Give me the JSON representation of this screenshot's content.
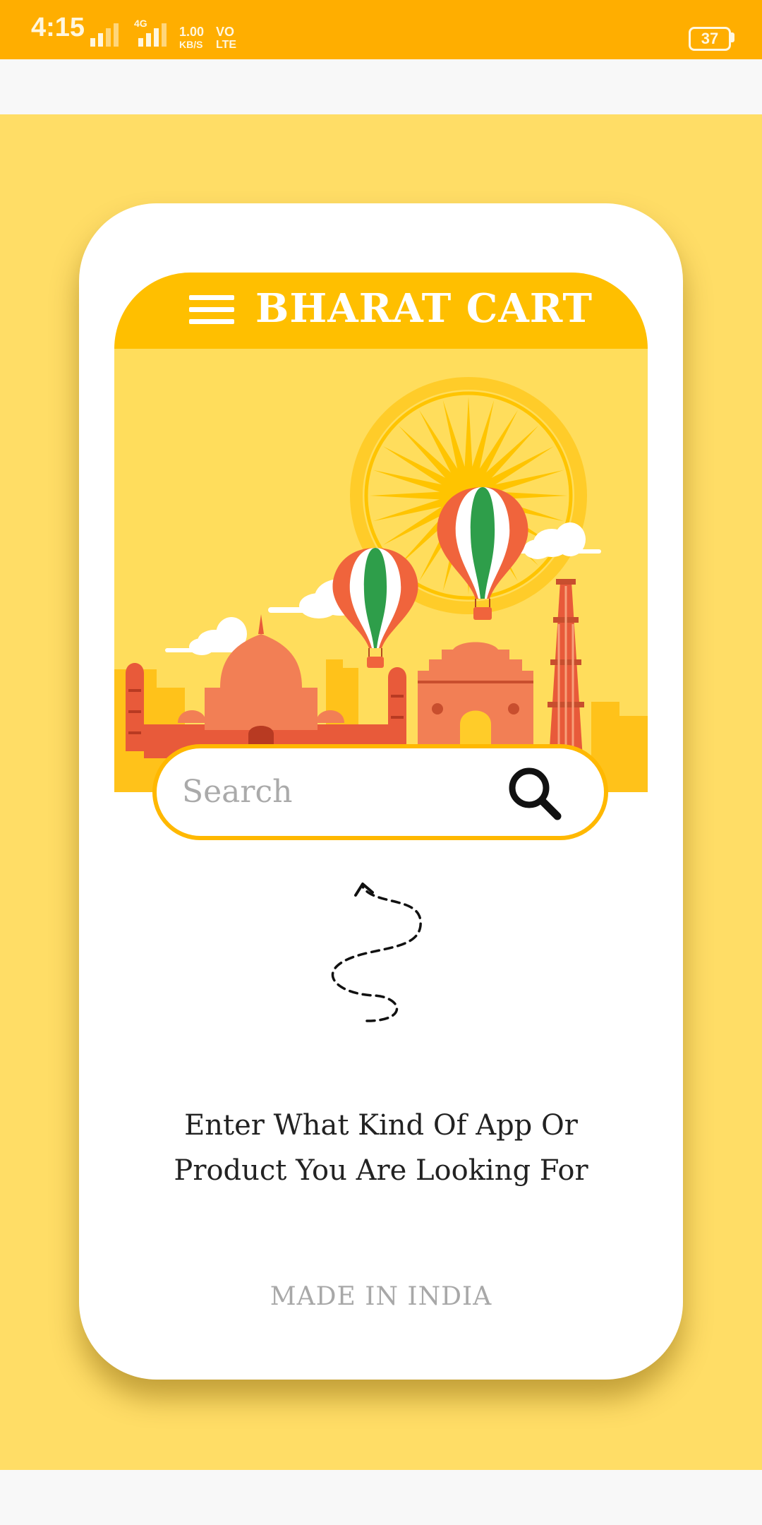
{
  "status_bar": {
    "time": "4:15",
    "network_type": "4G",
    "speed_value": "1.00",
    "speed_unit": "KB/S",
    "volte_top": "VO",
    "volte_bottom": "LTE",
    "battery": "37"
  },
  "header": {
    "title": "BHARAT CART",
    "menu_icon": "hamburger-menu-icon"
  },
  "search": {
    "placeholder": "Search",
    "icon": "search-icon"
  },
  "hint": {
    "line1": "Enter What Kind Of App Or",
    "line2": "Product You Are Looking For"
  },
  "footer": {
    "text": "MADE IN INDIA"
  },
  "colors": {
    "status_bar": "#FFAE00",
    "page_background": "#FFDD66",
    "header": "#FFBF00",
    "search_border": "#FFB800",
    "illustration_sky": "#FFDD5C"
  }
}
